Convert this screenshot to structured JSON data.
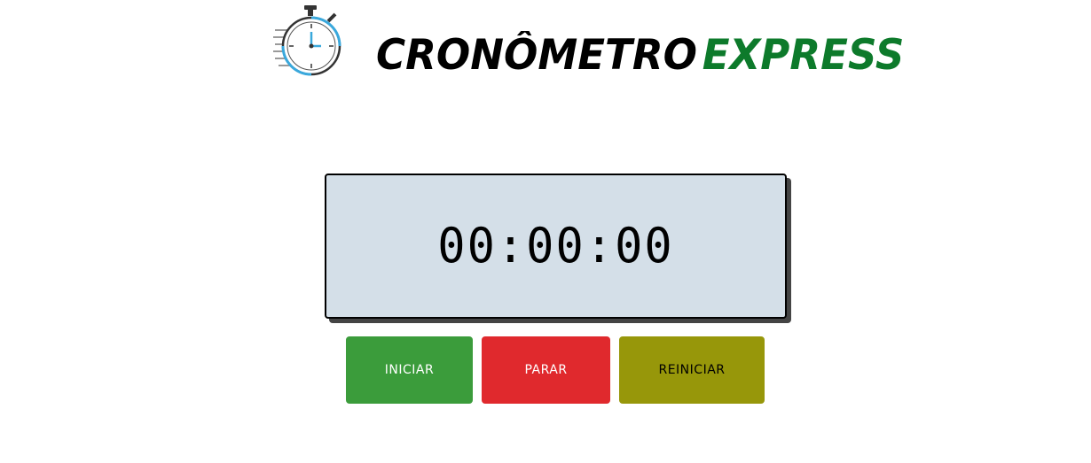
{
  "header": {
    "logo_icon": "stopwatch-icon",
    "title_part1": "CRONÔMETRO",
    "title_part2": "EXPRESS",
    "colors": {
      "title_main": "#000000",
      "title_accent": "#0d7a2b"
    }
  },
  "display": {
    "time": "00:00:00",
    "background": "#d4dfe8"
  },
  "buttons": {
    "start_label": "INICIAR",
    "stop_label": "PARAR",
    "reset_label": "REINICIAR",
    "colors": {
      "start": "#3b9c3b",
      "stop": "#e0292d",
      "reset": "#97970a"
    }
  }
}
